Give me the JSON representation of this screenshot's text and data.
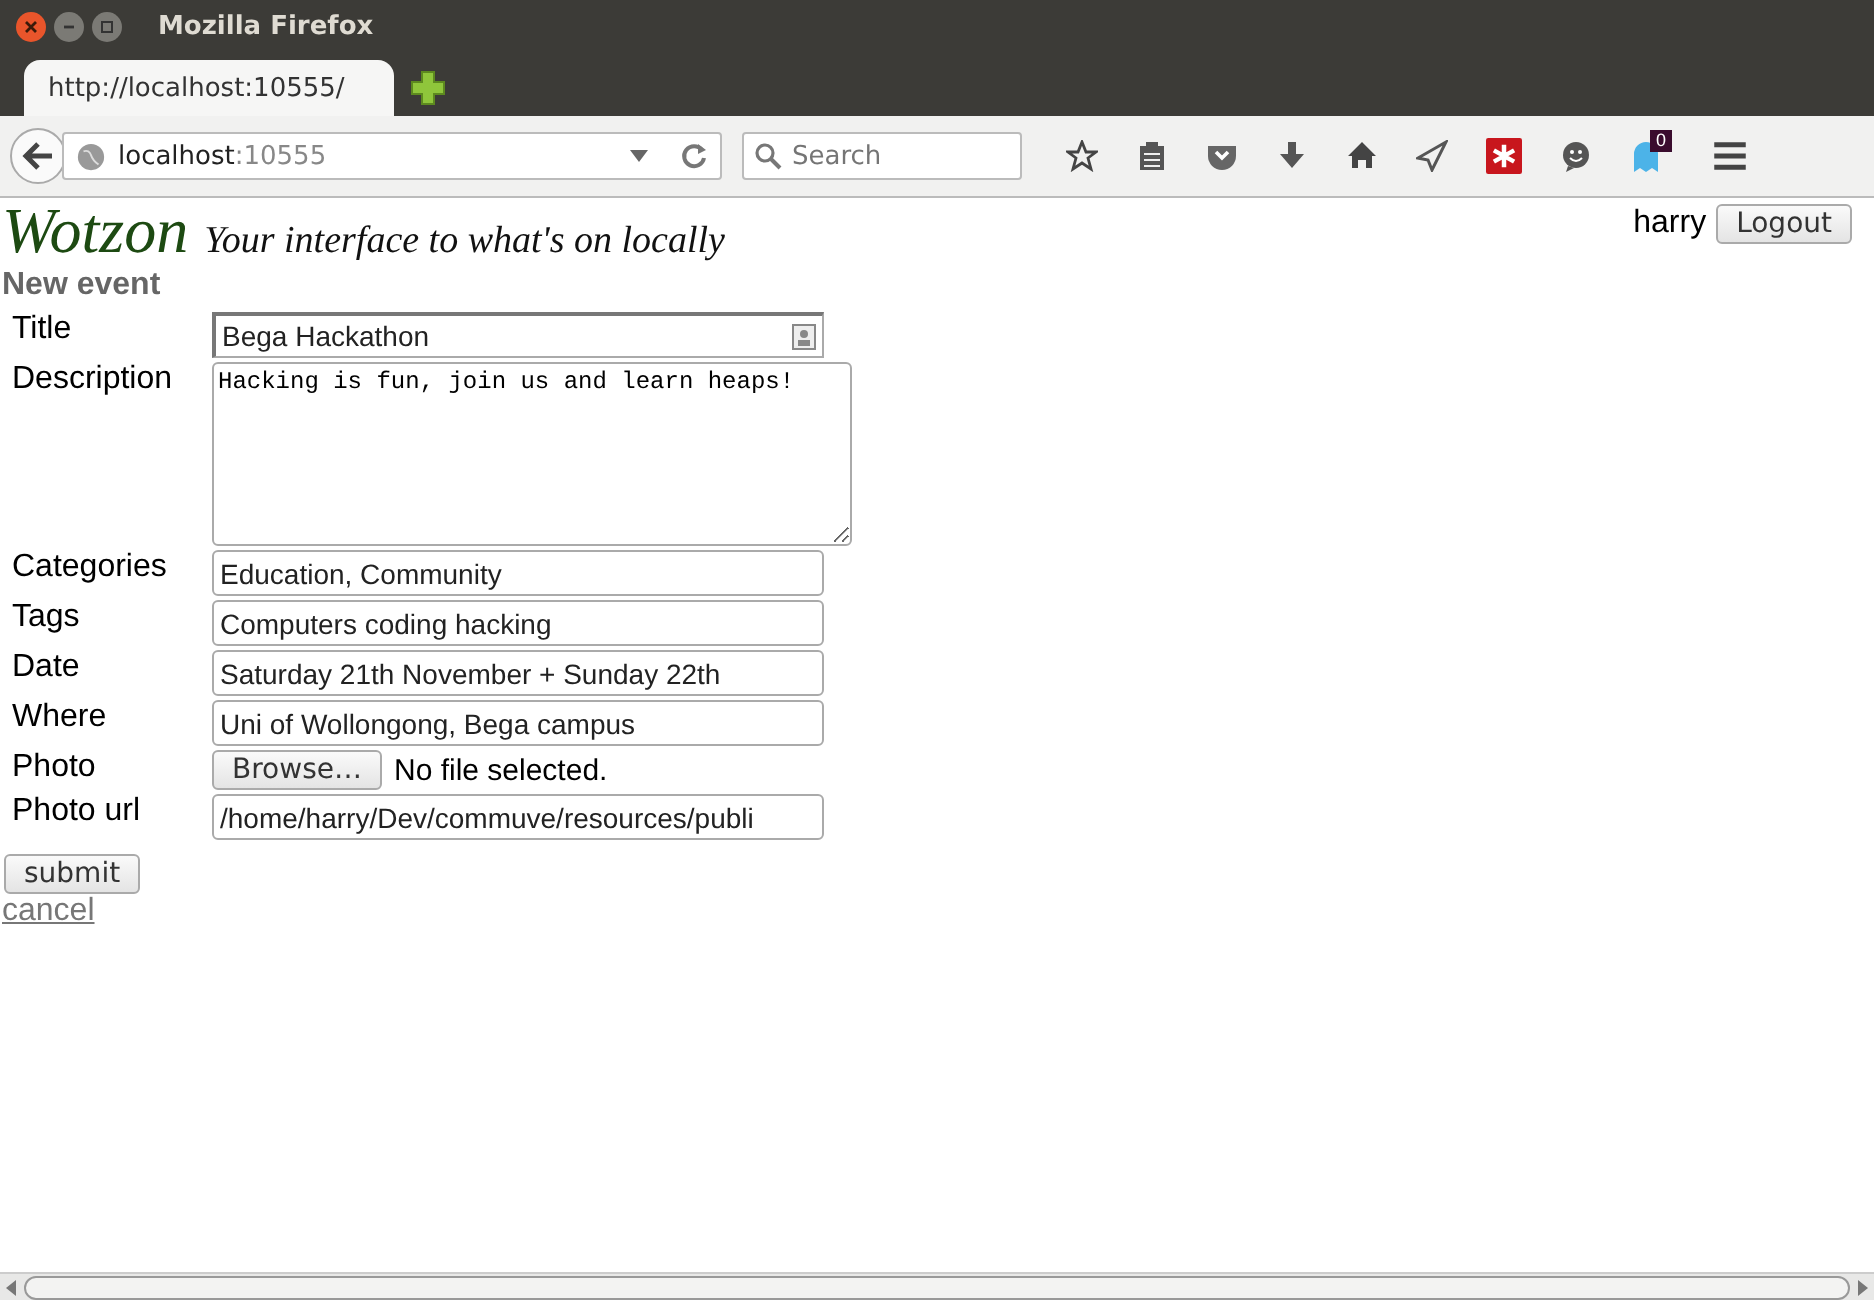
{
  "window": {
    "title": "Mozilla Firefox"
  },
  "tabs": [
    {
      "label": "http://localhost:10555/",
      "selected": true
    }
  ],
  "address_bar": {
    "host": "localhost",
    "port": ":10555"
  },
  "search": {
    "placeholder": "Search"
  },
  "toolbar": {
    "notification_count": "0"
  },
  "page": {
    "logo": "Wotzon",
    "tagline": "Your interface to what's on locally",
    "user": "harry",
    "logout": "Logout",
    "heading": "New event",
    "fields": [
      {
        "label": "Title",
        "kind": "text",
        "value": "Bega Hackathon"
      },
      {
        "label": "Description",
        "kind": "textarea",
        "value": "Hacking is fun, join us and learn heaps!"
      },
      {
        "label": "Categories",
        "kind": "text",
        "value": "Education, Community"
      },
      {
        "label": "Tags",
        "kind": "text",
        "value": "Computers coding hacking"
      },
      {
        "label": "Date",
        "kind": "text",
        "value": "Saturday 21th November + Sunday 22th"
      },
      {
        "label": "Where",
        "kind": "text",
        "value": "Uni of Wollongong, Bega campus"
      },
      {
        "label": "Photo",
        "kind": "file",
        "button": "Browse…",
        "status": "No file selected."
      },
      {
        "label": "Photo url",
        "kind": "text",
        "value": "/home/harry/Dev/commuve/resources/publi"
      }
    ],
    "submit": "submit",
    "cancel": "cancel"
  }
}
